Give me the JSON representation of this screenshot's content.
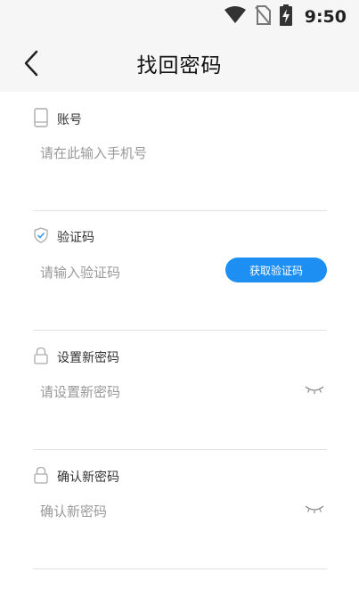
{
  "status_bar": {
    "time": "9:50",
    "icons": [
      "wifi-icon",
      "no-sim-icon",
      "battery-charging-icon"
    ]
  },
  "header": {
    "title": "找回密码",
    "back_icon": "chevron-left-icon"
  },
  "form": {
    "account": {
      "label": "账号",
      "icon": "phone-icon",
      "placeholder": "请在此输入手机号"
    },
    "code": {
      "label": "验证码",
      "icon": "shield-check-icon",
      "placeholder": "请输入验证码",
      "button_label": "获取验证码"
    },
    "new_password": {
      "label": "设置新密码",
      "icon": "lock-icon",
      "placeholder": "请设置新密码",
      "toggle_icon": "eye-closed-icon"
    },
    "confirm_password": {
      "label": "确认新密码",
      "icon": "lock-icon",
      "placeholder": "确认新密码",
      "toggle_icon": "eye-closed-icon"
    }
  },
  "colors": {
    "accent": "#1e8ff2",
    "header_bg": "#f6f6f6",
    "divider": "#e1e1e1"
  }
}
